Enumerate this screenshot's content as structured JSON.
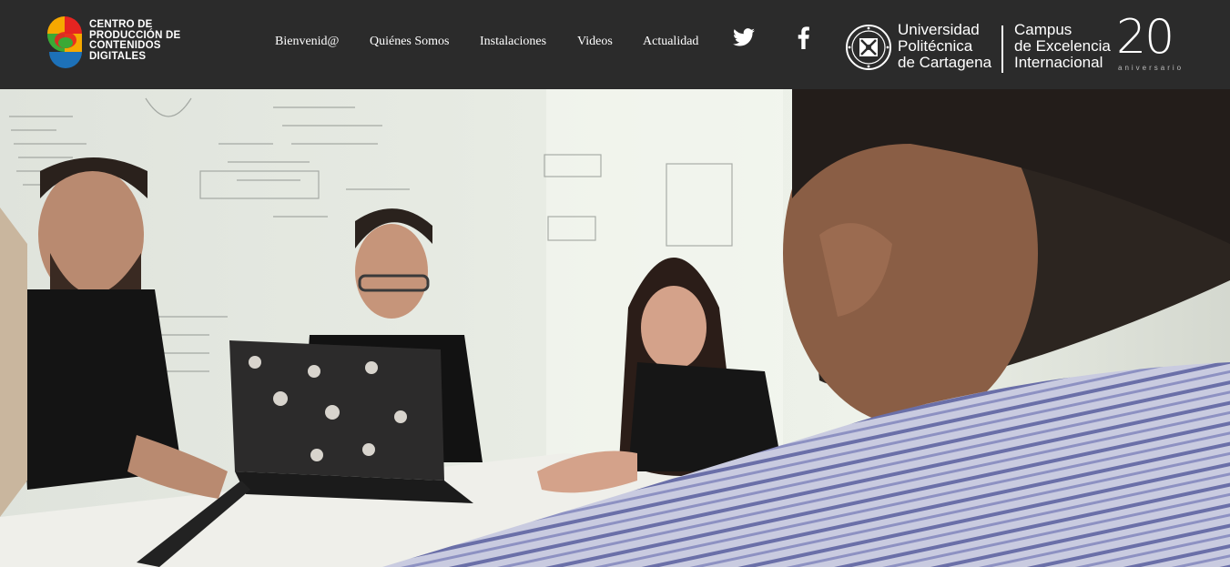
{
  "header": {
    "logo": {
      "lines": [
        "CENTRO DE",
        "PRODUCCIÓN DE",
        "CONTENIDOS",
        "DIGITALES"
      ],
      "colors": [
        "#e52421",
        "#f6a800",
        "#3aa935",
        "#1d71b8"
      ]
    },
    "nav": [
      {
        "label": "Bienvenid@"
      },
      {
        "label": "Quiénes Somos"
      },
      {
        "label": "Instalaciones"
      },
      {
        "label": "Videos"
      },
      {
        "label": "Actualidad"
      }
    ],
    "social": [
      {
        "icon": "twitter-icon"
      },
      {
        "icon": "facebook-icon"
      }
    ],
    "university": {
      "lines": [
        "Universidad",
        "Politécnica",
        "de Cartagena"
      ]
    },
    "campus": {
      "lines": [
        "Campus",
        "de Excelencia",
        "Internacional"
      ]
    },
    "anniversary": {
      "number": "20",
      "label": "aniversario"
    }
  },
  "hero": {
    "icon": "team-meeting-photo"
  }
}
